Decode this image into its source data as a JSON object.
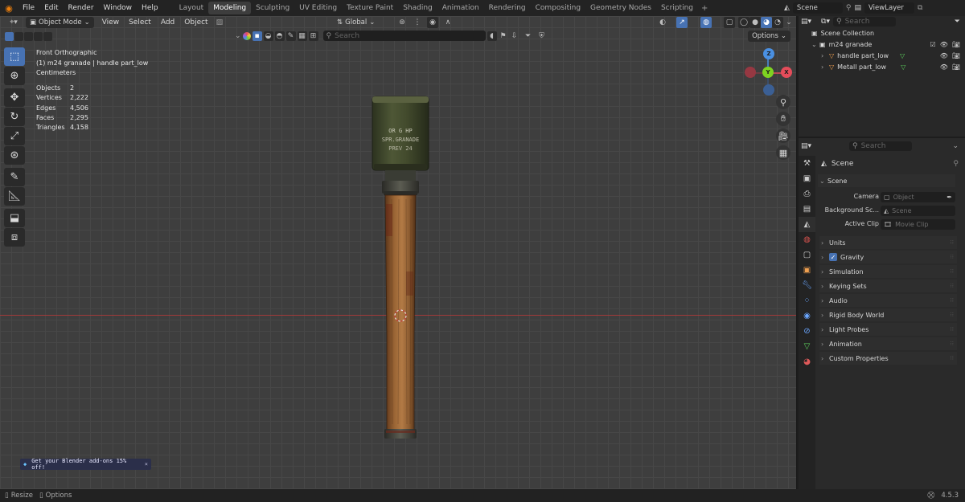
{
  "menu": {
    "file": "File",
    "edit": "Edit",
    "render": "Render",
    "window": "Window",
    "help": "Help"
  },
  "workspaces": [
    "Layout",
    "Modeling",
    "Sculpting",
    "UV Editing",
    "Texture Paint",
    "Shading",
    "Animation",
    "Rendering",
    "Compositing",
    "Geometry Nodes",
    "Scripting"
  ],
  "active_workspace": "Modeling",
  "scene_name": "Scene",
  "view_layer": "ViewLayer",
  "viewport_header": {
    "mode": "Object Mode",
    "view": "View",
    "select": "Select",
    "add": "Add",
    "object": "Object",
    "orientation": "Global",
    "search_placeholder": "Search",
    "options": "Options"
  },
  "overlay": {
    "view_name": "Front Orthographic",
    "object_name": "(1) m24 granade | handle part_low",
    "units": "Centimeters"
  },
  "stats": [
    {
      "label": "Objects",
      "value": "2"
    },
    {
      "label": "Vertices",
      "value": "2,222"
    },
    {
      "label": "Edges",
      "value": "4,506"
    },
    {
      "label": "Faces",
      "value": "2,295"
    },
    {
      "label": "Triangles",
      "value": "4,158"
    }
  ],
  "gizmo": {
    "x": "X",
    "y": "Y",
    "z": "Z"
  },
  "grenade_text": {
    "line1": "OR G HP",
    "line2": "SPR.GRANADE",
    "line3": "PREV 24"
  },
  "promo": {
    "text": "Get your Blender add-ons 15% off!",
    "close": "×"
  },
  "statusbar": {
    "resize": "Resize",
    "options": "Options",
    "version": "4.5.3"
  },
  "outliner": {
    "search_placeholder": "Search",
    "collection": "Scene Collection",
    "items": [
      {
        "name": "m24 granade",
        "level": 1
      },
      {
        "name": "handle part_low",
        "level": 2
      },
      {
        "name": "Metall part_low",
        "level": 2
      }
    ]
  },
  "properties": {
    "search_placeholder": "Search",
    "context": "Scene",
    "panel_title": "Scene",
    "fields": [
      {
        "label": "Camera",
        "placeholder": "Object"
      },
      {
        "label": "Background Sc...",
        "placeholder": "Scene"
      },
      {
        "label": "Active Clip",
        "placeholder": "Movie Clip"
      }
    ],
    "panels": [
      "Units",
      "Gravity",
      "Simulation",
      "Keying Sets",
      "Audio",
      "Rigid Body World",
      "Light Probes",
      "Animation",
      "Custom Properties"
    ]
  },
  "colors": {
    "accent": "#4772b3",
    "axis_x": "#e44c5a",
    "axis_y": "#7ed321",
    "axis_z": "#4a90e2",
    "grid_x_line": "#b33a3a"
  }
}
